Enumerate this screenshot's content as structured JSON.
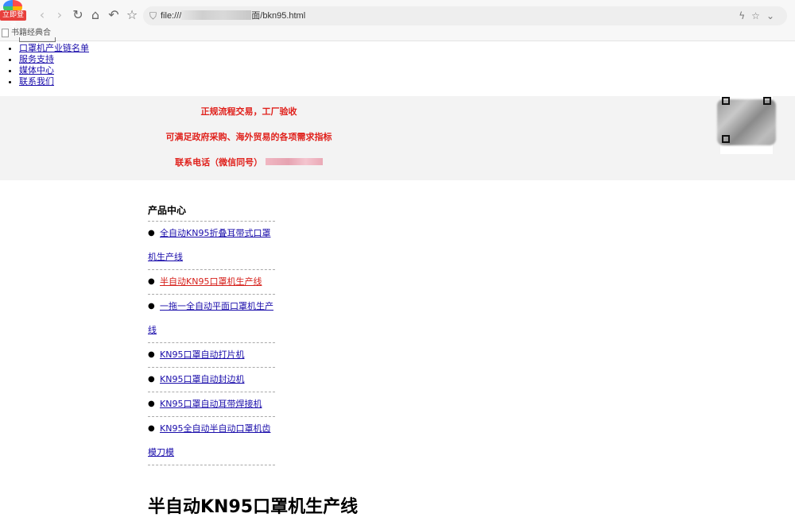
{
  "browser": {
    "login_badge": "立即登录",
    "url_prefix": "file:///",
    "url_suffix": "面/bkn95.html",
    "bookmark_label": "书籍经典合"
  },
  "top_nav": [
    {
      "label": "口罩机产业链名单"
    },
    {
      "label": "服务支持"
    },
    {
      "label": "媒体中心"
    },
    {
      "label": "联系我们"
    }
  ],
  "banner": {
    "line1": "正规流程交易，工厂验收",
    "line2": "可满足政府采购、海外贸易的各项需求指标",
    "line3": "联系电话（微信同号）",
    "accent_color": "#e0201b"
  },
  "sidebar": {
    "title": "产品中心",
    "items": [
      {
        "line1": "全自动KN95折叠耳带式口罩",
        "line2": "机生产线",
        "active": false
      },
      {
        "line1": "半自动KN95口罩机生产线",
        "line2": "",
        "active": true
      },
      {
        "line1": "一拖一全自动平面口罩机生产",
        "line2": "线",
        "active": false
      },
      {
        "line1": "KN95口罩自动打片机",
        "line2": "",
        "active": false
      },
      {
        "line1": "KN95口罩自动封边机",
        "line2": "",
        "active": false
      },
      {
        "line1": "KN95口罩自动耳带焊接机",
        "line2": "",
        "active": false
      },
      {
        "line1": "KN95全自动半自动口罩机齿",
        "line2": "模刀模",
        "active": false
      }
    ]
  },
  "main": {
    "heading": "半自动KN95口罩机生产线"
  },
  "colors": {
    "link": "#1a0dab",
    "active_link": "#d6201b",
    "banner_bg": "#f3f3f3"
  }
}
